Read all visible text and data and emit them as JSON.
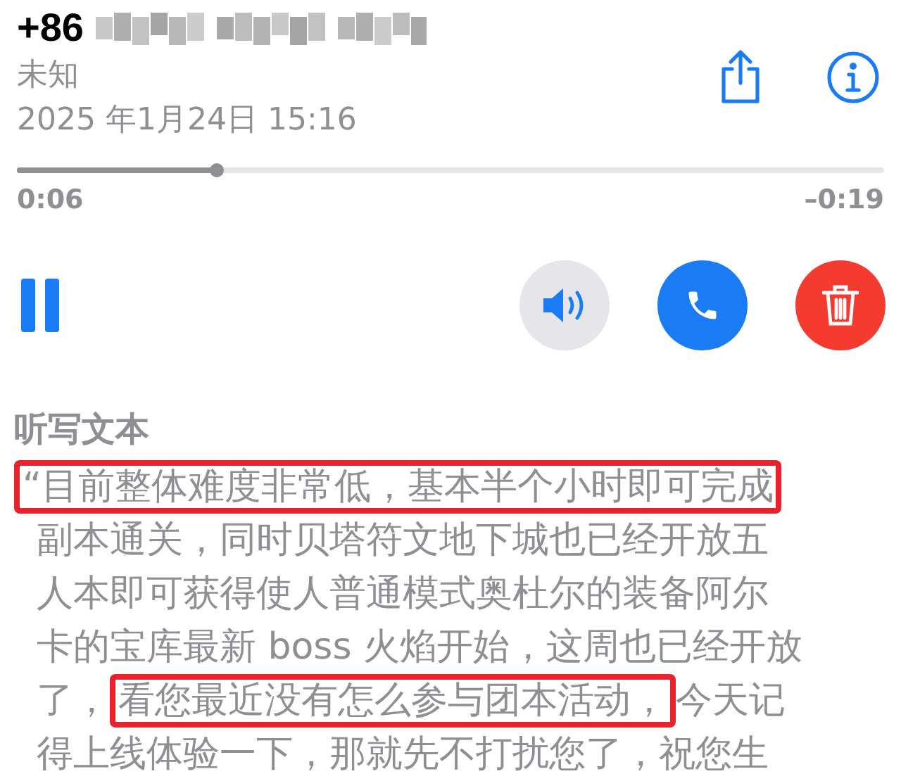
{
  "header": {
    "country_code": "+86",
    "label": "未知",
    "date": "2025 年1月24日 15:16"
  },
  "playback": {
    "level": 0.23,
    "elapsed": "0:06",
    "remaining": "–0:19",
    "playing": true,
    "speaker_on": false
  },
  "transcript": {
    "title": "听写文本",
    "lines": [
      [
        {
          "text": "“目前整体难度非常低，基本半个小时即可完成",
          "highlighted": true
        }
      ],
      [
        {
          "text": "副本通关，同时贝塔符文地下城也已经开放五",
          "highlighted": false
        }
      ],
      [
        {
          "text": "人本即可获得使人普通模式奥杜尔的装备阿尔",
          "highlighted": false
        }
      ],
      [
        {
          "text": "卡的宝库最新 boss 火焰开始，这周也已经开放",
          "highlighted": false
        }
      ],
      [
        {
          "text": "了，",
          "highlighted": false
        },
        {
          "text": "看您最近没有怎么参与团本活动，",
          "highlighted": true
        },
        {
          "text": "今天记",
          "highlighted": false
        }
      ],
      [
        {
          "text": "得上线体验一下，那就先不打扰您了，祝您生",
          "highlighted": false
        }
      ]
    ]
  }
}
